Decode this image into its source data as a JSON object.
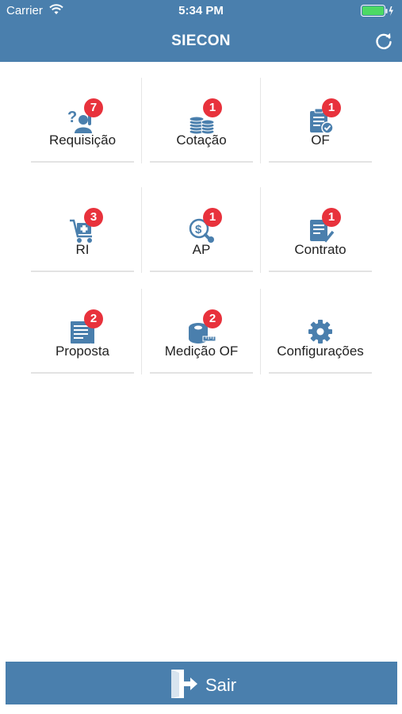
{
  "status_bar": {
    "carrier": "Carrier",
    "time": "5:34 PM"
  },
  "nav": {
    "title": "SIECON",
    "refresh_icon": "refresh-icon"
  },
  "menu": [
    {
      "label": "Requisição",
      "badge": "7",
      "icon": "requisition-icon"
    },
    {
      "label": "Cotação",
      "badge": "1",
      "icon": "coins-icon"
    },
    {
      "label": "OF",
      "badge": "1",
      "icon": "clipboard-check-icon"
    },
    {
      "label": "RI",
      "badge": "3",
      "icon": "cart-icon"
    },
    {
      "label": "AP",
      "badge": "1",
      "icon": "money-search-icon"
    },
    {
      "label": "Contrato",
      "badge": "1",
      "icon": "contract-icon"
    },
    {
      "label": "Proposta",
      "badge": "2",
      "icon": "document-icon"
    },
    {
      "label": "Medição OF",
      "badge": "2",
      "icon": "tape-measure-icon"
    },
    {
      "label": "Configurações",
      "badge": "",
      "icon": "gear-icon"
    }
  ],
  "footer": {
    "exit_label": "Sair",
    "exit_icon": "exit-door-icon"
  },
  "colors": {
    "primary": "#4a7fad",
    "badge": "#e8323c"
  }
}
